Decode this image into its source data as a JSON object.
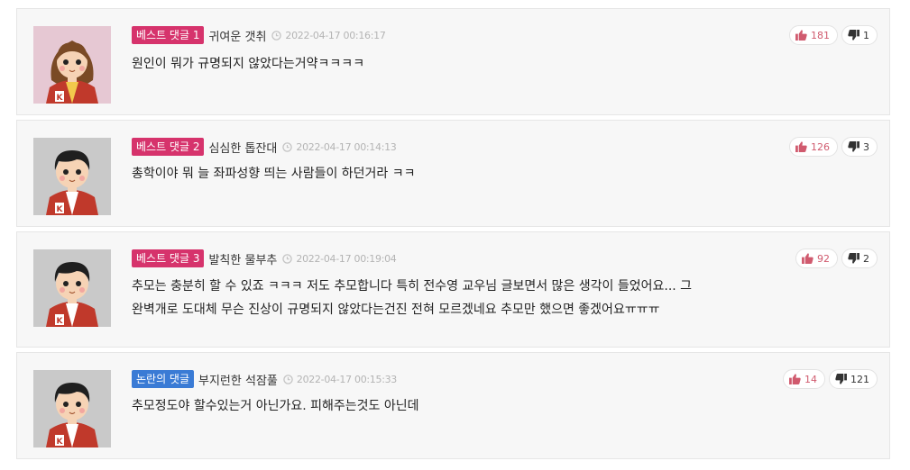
{
  "colors": {
    "best": "#d6336c",
    "controversial": "#3a7bd5",
    "like": "#d05a6e",
    "dislike": "#333333"
  },
  "comments": [
    {
      "badge": "베스트 댓글 1",
      "nickname": "귀여운 갯취",
      "time": "2022-04-17 00:16:17",
      "text": "원인이 뭐가 규명되지 않았다는거약ㅋㅋㅋㅋ",
      "likes": "181",
      "dislikes": "1",
      "avatar": "girl-avatar"
    },
    {
      "badge": "베스트 댓글 2",
      "nickname": "심심한 톱잔대",
      "time": "2022-04-17 00:14:13",
      "text": "총학이야 뭐 늘 좌파성향 띄는 사람들이 하던거라 ㅋㅋ",
      "likes": "126",
      "dislikes": "3",
      "avatar": "boy-avatar"
    },
    {
      "badge": "베스트 댓글 3",
      "nickname": "발칙한 물부추",
      "time": "2022-04-17 00:19:04",
      "text_line1": "추모는 충분히 할 수 있죠 ㅋㅋㅋ 저도 추모합니다 특히 전수영 교우님 글보면서 많은 생각이 들었어요... 그",
      "text_line2": "완벽개로 도대체 무슨 진상이 규명되지 않았다는건진 전혀 모르겠네요 추모만 했으면 좋겠어요ㅠㅠㅠ",
      "likes": "92",
      "dislikes": "2",
      "avatar": "boy-avatar"
    },
    {
      "badge": "논란의 댓글",
      "nickname": "부지런한 석잠풀",
      "time": "2022-04-17 00:15:33",
      "text": "추모정도야 할수있는거 아닌가요. 피해주는것도 아닌데",
      "likes": "14",
      "dislikes": "121",
      "avatar": "boy-avatar"
    }
  ]
}
